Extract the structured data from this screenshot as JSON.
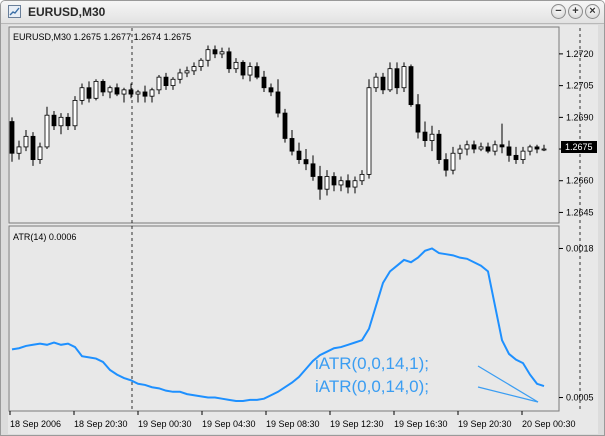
{
  "window": {
    "title": "EURUSD,M30",
    "buttons": {
      "minimize": "−",
      "maximize": "+",
      "close": "×"
    }
  },
  "price_pane": {
    "header": "EURUSD,M30  1.2675 1.2677 1.2674 1.2675",
    "current_price": "1.2675"
  },
  "atr_pane": {
    "header": "ATR(14) 0.0006"
  },
  "annotations": [
    "iATR(0,0,14,1);",
    "iATR(0,0,14,0);"
  ],
  "colors": {
    "atr_line": "#1e90ff",
    "annotation": "#3a9df2",
    "candle": "#000000",
    "price_label_bg": "#000000"
  },
  "chart_data": [
    {
      "type": "candlestick",
      "title": "EURUSD,M30  1.2675 1.2677 1.2674 1.2675",
      "yticks": [
        "1.2720",
        "1.2705",
        "1.2690",
        "1.2675",
        "1.2660",
        "1.2645"
      ],
      "ylim": [
        1.264,
        1.2728
      ],
      "grid": false,
      "candles": [
        [
          1.2688,
          1.269,
          1.2669,
          1.2673
        ],
        [
          1.2673,
          1.2679,
          1.267,
          1.2676
        ],
        [
          1.2676,
          1.2684,
          1.2674,
          1.2681
        ],
        [
          1.2681,
          1.2683,
          1.2667,
          1.267
        ],
        [
          1.267,
          1.2678,
          1.2668,
          1.2676
        ],
        [
          1.2676,
          1.2695,
          1.2675,
          1.2691
        ],
        [
          1.2691,
          1.2693,
          1.2684,
          1.2686
        ],
        [
          1.2686,
          1.2692,
          1.2682,
          1.269
        ],
        [
          1.269,
          1.2692,
          1.2684,
          1.2686
        ],
        [
          1.2686,
          1.27,
          1.2684,
          1.2698
        ],
        [
          1.2698,
          1.2706,
          1.2696,
          1.2704
        ],
        [
          1.2704,
          1.2707,
          1.2697,
          1.2699
        ],
        [
          1.2699,
          1.2708,
          1.2698,
          1.2707
        ],
        [
          1.2707,
          1.2708,
          1.27,
          1.2702
        ],
        [
          1.2702,
          1.2705,
          1.2699,
          1.2704
        ],
        [
          1.2704,
          1.2706,
          1.27,
          1.2701
        ],
        [
          1.2701,
          1.2704,
          1.2697,
          1.2703
        ],
        [
          1.2703,
          1.2706,
          1.2699,
          1.2701
        ],
        [
          1.2701,
          1.2703,
          1.2697,
          1.2702
        ],
        [
          1.2702,
          1.2705,
          1.2697,
          1.27
        ],
        [
          1.27,
          1.2704,
          1.2697,
          1.2703
        ],
        [
          1.2703,
          1.271,
          1.2701,
          1.2709
        ],
        [
          1.2709,
          1.2711,
          1.2703,
          1.2705
        ],
        [
          1.2705,
          1.2709,
          1.2703,
          1.2708
        ],
        [
          1.2708,
          1.2713,
          1.2706,
          1.2711
        ],
        [
          1.2711,
          1.2714,
          1.2709,
          1.2712
        ],
        [
          1.2712,
          1.2716,
          1.271,
          1.2714
        ],
        [
          1.2714,
          1.2718,
          1.2712,
          1.2717
        ],
        [
          1.2717,
          1.2724,
          1.2714,
          1.2722
        ],
        [
          1.2722,
          1.2724,
          1.2718,
          1.272
        ],
        [
          1.272,
          1.2723,
          1.2718,
          1.2721
        ],
        [
          1.2721,
          1.2723,
          1.2711,
          1.2713
        ],
        [
          1.2713,
          1.2718,
          1.2711,
          1.2716
        ],
        [
          1.2716,
          1.2717,
          1.2708,
          1.271
        ],
        [
          1.271,
          1.2716,
          1.2707,
          1.2714
        ],
        [
          1.2714,
          1.2716,
          1.2708,
          1.2709
        ],
        [
          1.2709,
          1.2712,
          1.2702,
          1.2704
        ],
        [
          1.2704,
          1.2706,
          1.27,
          1.2702
        ],
        [
          1.2702,
          1.2708,
          1.269,
          1.2692
        ],
        [
          1.2692,
          1.2694,
          1.2678,
          1.268
        ],
        [
          1.268,
          1.2684,
          1.2672,
          1.2674
        ],
        [
          1.2674,
          1.2678,
          1.2668,
          1.267
        ],
        [
          1.267,
          1.2675,
          1.2665,
          1.2668
        ],
        [
          1.2668,
          1.2672,
          1.266,
          1.2662
        ],
        [
          1.2662,
          1.2667,
          1.2651,
          1.2656
        ],
        [
          1.2656,
          1.2665,
          1.2653,
          1.2662
        ],
        [
          1.2662,
          1.2664,
          1.2655,
          1.2658
        ],
        [
          1.2658,
          1.2662,
          1.2655,
          1.266
        ],
        [
          1.266,
          1.2663,
          1.2654,
          1.2657
        ],
        [
          1.2657,
          1.2662,
          1.2654,
          1.266
        ],
        [
          1.266,
          1.2665,
          1.2658,
          1.2663
        ],
        [
          1.2663,
          1.2708,
          1.2661,
          1.2704
        ],
        [
          1.2704,
          1.2711,
          1.2702,
          1.2709
        ],
        [
          1.2709,
          1.2711,
          1.2701,
          1.2703
        ],
        [
          1.2703,
          1.2716,
          1.2702,
          1.2713
        ],
        [
          1.2713,
          1.2716,
          1.2701,
          1.2704
        ],
        [
          1.2704,
          1.2716,
          1.2702,
          1.2714
        ],
        [
          1.2714,
          1.2715,
          1.2695,
          1.2696
        ],
        [
          1.2696,
          1.2701,
          1.268,
          1.2683
        ],
        [
          1.2683,
          1.2688,
          1.2676,
          1.2679
        ],
        [
          1.2679,
          1.2686,
          1.2674,
          1.2682
        ],
        [
          1.2682,
          1.2684,
          1.2668,
          1.267
        ],
        [
          1.267,
          1.2673,
          1.2662,
          1.2665
        ],
        [
          1.2665,
          1.2676,
          1.2663,
          1.2673
        ],
        [
          1.2673,
          1.2677,
          1.267,
          1.2675
        ],
        [
          1.2675,
          1.2679,
          1.2672,
          1.2677
        ],
        [
          1.2677,
          1.2679,
          1.2673,
          1.2675
        ],
        [
          1.2675,
          1.2678,
          1.2674,
          1.2676
        ],
        [
          1.2676,
          1.2678,
          1.2673,
          1.2674
        ],
        [
          1.2674,
          1.2679,
          1.2672,
          1.2677
        ],
        [
          1.2677,
          1.2687,
          1.2673,
          1.2676
        ],
        [
          1.2676,
          1.2679,
          1.2669,
          1.2672
        ],
        [
          1.2672,
          1.2676,
          1.2668,
          1.267
        ],
        [
          1.267,
          1.2676,
          1.2668,
          1.2674
        ],
        [
          1.2674,
          1.2677,
          1.2672,
          1.2676
        ],
        [
          1.2676,
          1.2677,
          1.2673,
          1.2675
        ],
        [
          1.2675,
          1.2677,
          1.2674,
          1.2675
        ]
      ],
      "period_separators": [
        "18 Sep 20:30",
        "20 Sep 00:30"
      ]
    },
    {
      "type": "line",
      "title": "ATR(14) 0.0006",
      "yticks": [
        "0.0018",
        "0.0005"
      ],
      "ylim": [
        0.0004,
        0.0019
      ],
      "grid": false,
      "series": [
        {
          "values": [
            0.00092,
            0.00093,
            0.00095,
            0.00096,
            0.00097,
            0.00096,
            0.00098,
            0.00096,
            0.00097,
            0.00094,
            0.00086,
            0.00085,
            0.00084,
            0.00081,
            0.00074,
            0.0007,
            0.00067,
            0.00065,
            0.00062,
            0.00061,
            0.00059,
            0.00058,
            0.00056,
            0.00055,
            0.00055,
            0.00053,
            0.00052,
            0.00051,
            0.0005,
            0.0005,
            0.00049,
            0.00048,
            0.00047,
            0.00047,
            0.00048,
            0.00048,
            0.00049,
            0.00052,
            0.00055,
            0.00059,
            0.00063,
            0.00068,
            0.00075,
            0.00082,
            0.00087,
            0.0009,
            0.00093,
            0.00094,
            0.00096,
            0.00098,
            0.001,
            0.0011,
            0.0013,
            0.0015,
            0.0016,
            0.00165,
            0.0017,
            0.00168,
            0.00172,
            0.00178,
            0.0018,
            0.00176,
            0.00175,
            0.00174,
            0.00172,
            0.00171,
            0.00168,
            0.00165,
            0.0016,
            0.0013,
            0.001,
            0.00088,
            0.00083,
            0.0008,
            0.0007,
            0.00062,
            0.0006
          ]
        }
      ]
    }
  ],
  "x_axis": [
    "18 Sep 2006",
    "18 Sep 20:30",
    "19 Sep 00:30",
    "19 Sep 04:30",
    "19 Sep 08:30",
    "19 Sep 12:30",
    "19 Sep 16:30",
    "19 Sep 20:30",
    "20 Sep 00:30"
  ]
}
